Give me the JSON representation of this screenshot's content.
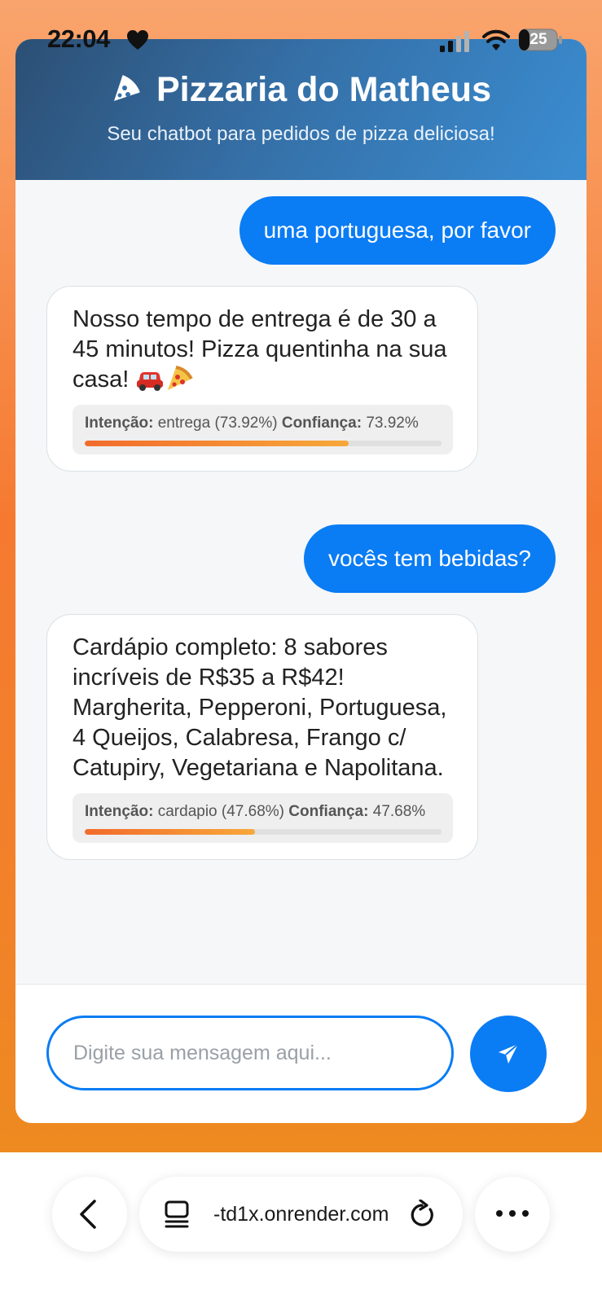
{
  "status_bar": {
    "time": "22:04",
    "battery_level": "25",
    "icons": [
      "heart-icon",
      "signal-icon",
      "wifi-icon",
      "battery-icon"
    ]
  },
  "header": {
    "icon": "pizza-slice-icon",
    "title": "Pizzaria do Matheus",
    "subtitle": "Seu chatbot para pedidos de pizza deliciosa!"
  },
  "chat": {
    "messages": [
      {
        "from": "user",
        "text": "uma portuguesa, por favor"
      },
      {
        "from": "bot",
        "text": "Nosso tempo de entrega é de 30 a 45 minutos! Pizza quentinha na sua casa!",
        "emojis": [
          "car-emoji",
          "pizza-emoji"
        ],
        "intent_label": "Intenção:",
        "intent_value": "entrega (73.92%)",
        "confidence_label": "Confiança:",
        "confidence_value": "73.92%",
        "confidence": 0.7392
      },
      {
        "from": "user",
        "text": "vocês tem bebidas?"
      },
      {
        "from": "bot",
        "text": "Cardápio completo: 8 sabores incríveis de R$35 a R$42! Margherita, Pepperoni, Portuguesa, 4 Queijos, Calabresa, Frango c/ Catupiry, Vegetariana e Napolitana.",
        "intent_label": "Intenção:",
        "intent_value": "cardapio (47.68%)",
        "confidence_label": "Confiança:",
        "confidence_value": "47.68%",
        "confidence": 0.4768
      }
    ]
  },
  "composer": {
    "placeholder": "Digite sua mensagem aqui...",
    "value": "",
    "send_icon": "send-icon"
  },
  "browser": {
    "url": "-td1x.onrender.com",
    "icons": [
      "back-icon",
      "tabs-icon",
      "reload-icon",
      "more-icon"
    ]
  },
  "colors": {
    "accent": "#0a7cf4",
    "header_start": "#2c4f74",
    "header_end": "#3a8dd2",
    "page_orange": "#f57a30",
    "confidence_start": "#f26b2c",
    "confidence_end": "#f7a83a"
  }
}
